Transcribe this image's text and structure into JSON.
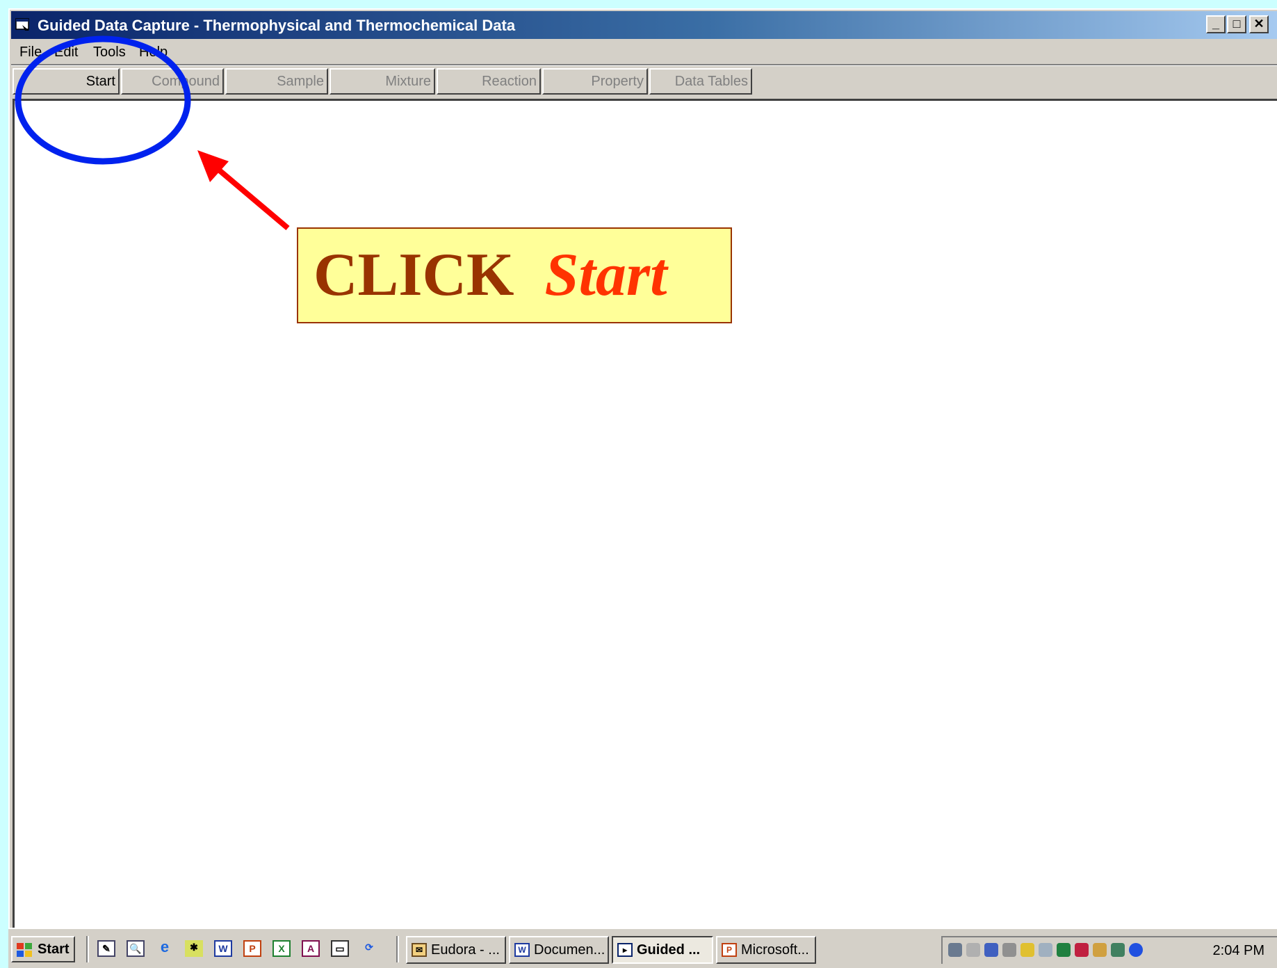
{
  "window": {
    "title": "Guided Data Capture - Thermophysical and Thermochemical Data",
    "minimize_glyph": "_",
    "maximize_glyph": "□",
    "close_glyph": "✕"
  },
  "menu": [
    "File",
    "Edit",
    "Tools",
    "Help"
  ],
  "tabs": [
    {
      "label": "Start",
      "enabled": true
    },
    {
      "label": "Compound",
      "enabled": false
    },
    {
      "label": "Sample",
      "enabled": false
    },
    {
      "label": "Mixture",
      "enabled": false
    },
    {
      "label": "Reaction",
      "enabled": false
    },
    {
      "label": "Property",
      "enabled": false
    },
    {
      "label": "Data Tables",
      "enabled": false
    }
  ],
  "callout": {
    "word1": "CLICK",
    "word2": "Start"
  },
  "annotation": {
    "ellipse_color": "#0022ee",
    "arrow_color": "#ff0000"
  },
  "taskbar": {
    "start_label": "Start",
    "quick_launch_icons": [
      "desktop-icon",
      "search-icon",
      "internet-explorer-icon",
      "network-icon",
      "word-icon",
      "powerpoint-icon",
      "excel-icon",
      "access-icon",
      "outlook-icon",
      "refresh-icon"
    ],
    "tasks": [
      {
        "label": "Eudora - ...",
        "icon": "eudora-icon",
        "active": false
      },
      {
        "label": "Documen...",
        "icon": "word-doc-icon",
        "active": false
      },
      {
        "label": "Guided ...",
        "icon": "app-icon",
        "active": true
      },
      {
        "label": "Microsoft...",
        "icon": "powerpoint-icon",
        "active": false
      }
    ],
    "clock": "2:04 PM"
  },
  "colors": {
    "desktop": "#ccffff",
    "titlebar_start": "#0a246a",
    "titlebar_end": "#a6caf0",
    "callout_bg": "#ffff99",
    "callout_word1": "#993300",
    "callout_word2": "#ff3300"
  }
}
